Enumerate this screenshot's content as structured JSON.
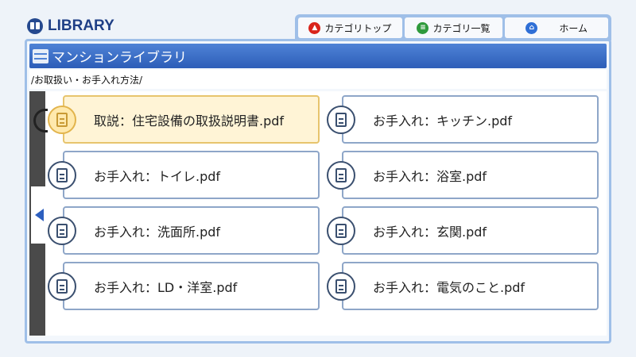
{
  "header": {
    "app_title": "LIBRARY"
  },
  "nav": {
    "category_top": "カテゴリトップ",
    "category_list": "カテゴリ一覧",
    "home": "ホーム"
  },
  "panel": {
    "title": "マンションライブラリ",
    "breadcrumb": "/お取扱い・お手入れ方法/"
  },
  "files": [
    {
      "label": "取説：住宅設備の取扱説明書.pdf",
      "selected": true
    },
    {
      "label": "お手入れ：キッチン.pdf",
      "selected": false
    },
    {
      "label": "お手入れ：トイレ.pdf",
      "selected": false
    },
    {
      "label": "お手入れ：浴室.pdf",
      "selected": false
    },
    {
      "label": "お手入れ：洗面所.pdf",
      "selected": false
    },
    {
      "label": "お手入れ：玄関.pdf",
      "selected": false
    },
    {
      "label": "お手入れ：LD・洋室.pdf",
      "selected": false
    },
    {
      "label": "お手入れ：電気のこと.pdf",
      "selected": false
    }
  ],
  "icons": {
    "logo": "book-icon",
    "category_top": "up-arrow-icon",
    "category_list": "list-icon",
    "home": "home-icon",
    "panel": "cabinet-icon",
    "file": "document-icon",
    "nav_left": "left-arrow-icon"
  },
  "colors": {
    "accent": "#2c5db8",
    "selected_bg": "#fff4d6",
    "frame": "#9fbfe8"
  }
}
